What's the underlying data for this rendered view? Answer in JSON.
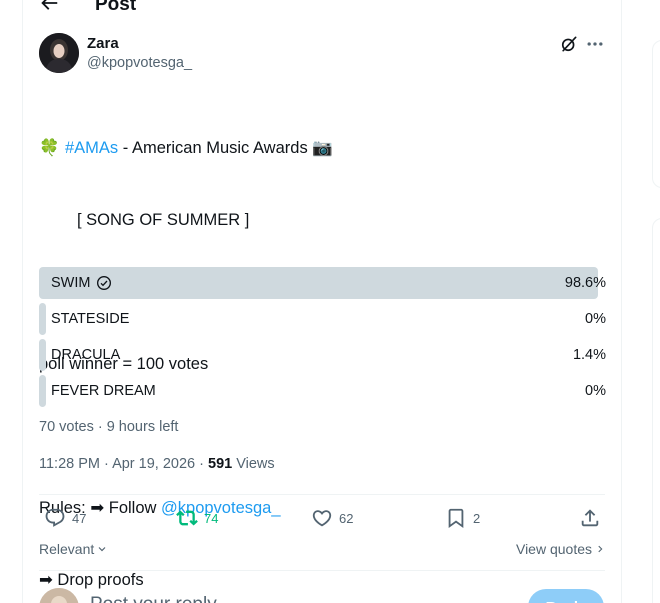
{
  "header": {
    "title": "Post"
  },
  "author": {
    "name": "Zara",
    "handle": "@kpopvotesga_"
  },
  "tweet": {
    "line1_emoji": "🍀",
    "line1_hashtag": "#AMAs",
    "line1_rest": " - American Music Awards ",
    "line1_camera": "📷",
    "line2": "[ SONG OF SUMMER ]",
    "line3": "poll winner = 100 votes",
    "line4_prefix": "Rules: ➡ Follow ",
    "line4_mention": "@kpopvotesga_",
    "line5": "➡ Drop proofs"
  },
  "poll": {
    "options": [
      {
        "label": "SWIM",
        "percent_text": "98.6%",
        "percent": 98.6,
        "winner": true
      },
      {
        "label": "STATESIDE",
        "percent_text": "0%",
        "percent": 0,
        "winner": false
      },
      {
        "label": "DRACULA",
        "percent_text": "1.4%",
        "percent": 1.4,
        "winner": false
      },
      {
        "label": "FEVER DREAM",
        "percent_text": "0%",
        "percent": 0,
        "winner": false
      }
    ],
    "meta": "70 votes · 9 hours left"
  },
  "timestamp": {
    "time": "11:28 PM · Apr 19, 2026 · ",
    "views_count": "591",
    "views_label": " Views"
  },
  "actions": {
    "replies": "47",
    "reposts": "74",
    "likes": "62",
    "bookmarks": "2"
  },
  "filters": {
    "relevant_label": "Relevant",
    "view_quotes_label": "View quotes"
  },
  "reply": {
    "placeholder": "Post your reply",
    "button_label": "Reply"
  },
  "colors": {
    "link": "#1d9bf0",
    "repost_active": "#00ba7c",
    "poll_bar": "#cfd9de",
    "muted": "#536471"
  }
}
